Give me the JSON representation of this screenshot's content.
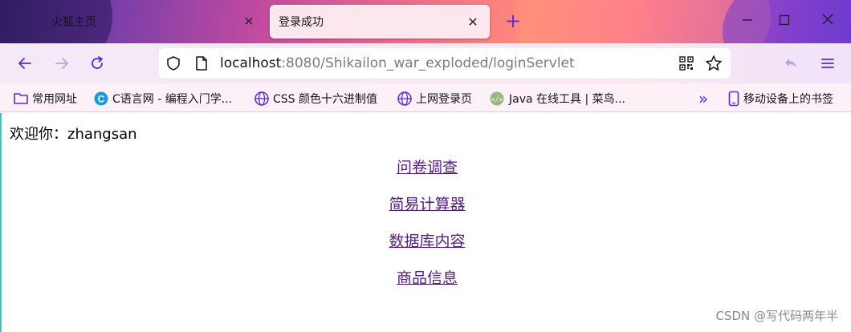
{
  "tabs": [
    {
      "label": "火狐主页",
      "active": false
    },
    {
      "label": "登录成功",
      "active": true
    }
  ],
  "address_bar": {
    "host": "localhost",
    "rest": ":8080/Shikailon_war_exploded/loginServlet"
  },
  "bookmarks": [
    {
      "label": "常用网址",
      "icon": "folder-icon"
    },
    {
      "label": "C语言网 - 编程入门学...",
      "icon": "c-site-icon"
    },
    {
      "label": "CSS 颜色十六进制值",
      "icon": "globe-icon"
    },
    {
      "label": "上网登录页",
      "icon": "globe-icon"
    },
    {
      "label": "Java 在线工具 | 菜鸟...",
      "icon": "runoob-icon"
    }
  ],
  "bookmarks_overflow_label": "»",
  "mobile_bookmarks": "移动设备上的书签",
  "page": {
    "welcome": "欢迎你：zhangsan",
    "links": [
      "问卷调查",
      "简易计算器",
      "数据库内容",
      "商品信息"
    ]
  },
  "watermark": "CSDN @写代码两年半",
  "colors": {
    "accent": "#5b2bd6",
    "link_visited": "#551a8b"
  }
}
